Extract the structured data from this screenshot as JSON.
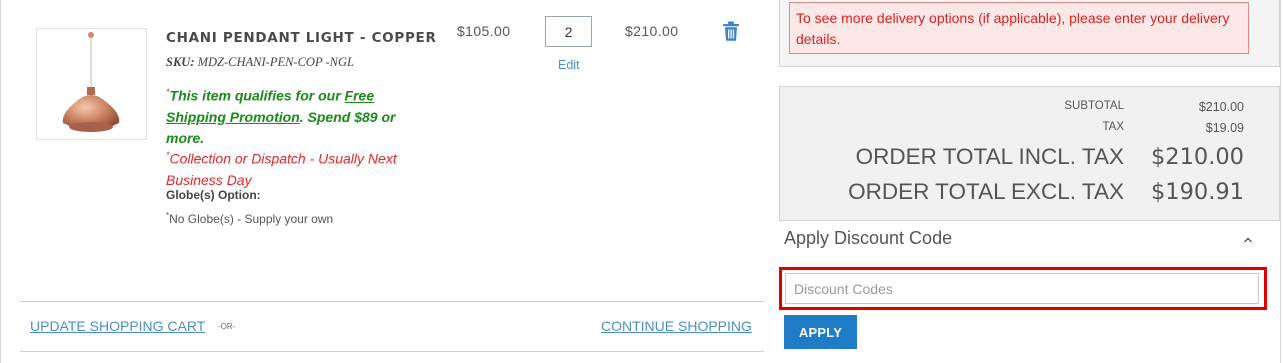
{
  "product": {
    "name": "CHANI PENDANT LIGHT - COPPER",
    "sku_label": "SKU:",
    "sku_value": "MDZ-CHANI-PEN-COP -NGL",
    "promo_prefix": "This item qualifies for our ",
    "promo_link": "Free Shipping Promotion",
    "promo_suffix": ". Spend $89 or more.",
    "dispatch_note": "Collection or Dispatch - Usually Next Business Day",
    "option_label": "Globe(s) Option:",
    "option_value": "No Globe(s) - Supply your own",
    "unit_price": "$105.00",
    "quantity": "2",
    "edit_label": "Edit",
    "line_subtotal": "$210.00",
    "image_icon": "pendant-lamp-image",
    "delete_icon": "trash-icon"
  },
  "cart_actions": {
    "update_label": "UPDATE SHOPPING CART",
    "separator": "-OR-",
    "continue_label": "CONTINUE SHOPPING"
  },
  "shipping": {
    "message": "To see more delivery options (if applicable), please enter your delivery details."
  },
  "totals": {
    "subtotal_label": "SUBTOTAL",
    "subtotal_value": "$210.00",
    "tax_label": "TAX",
    "tax_value": "$19.09",
    "incl_label": "ORDER TOTAL INCL. TAX",
    "incl_value": "$210.00",
    "excl_label": "ORDER TOTAL EXCL. TAX",
    "excl_value": "$190.91"
  },
  "discount": {
    "title": "Apply Discount Code",
    "placeholder": "Discount Codes",
    "value": "",
    "apply_label": "APPLY",
    "toggle_icon": "chevron-up-icon"
  },
  "colors": {
    "link_blue": "#4b8fc6",
    "button_blue": "#1e7bc6",
    "promo_green": "#1a8a1a",
    "dispatch_red": "#e22828",
    "highlight_red": "#e00000"
  }
}
